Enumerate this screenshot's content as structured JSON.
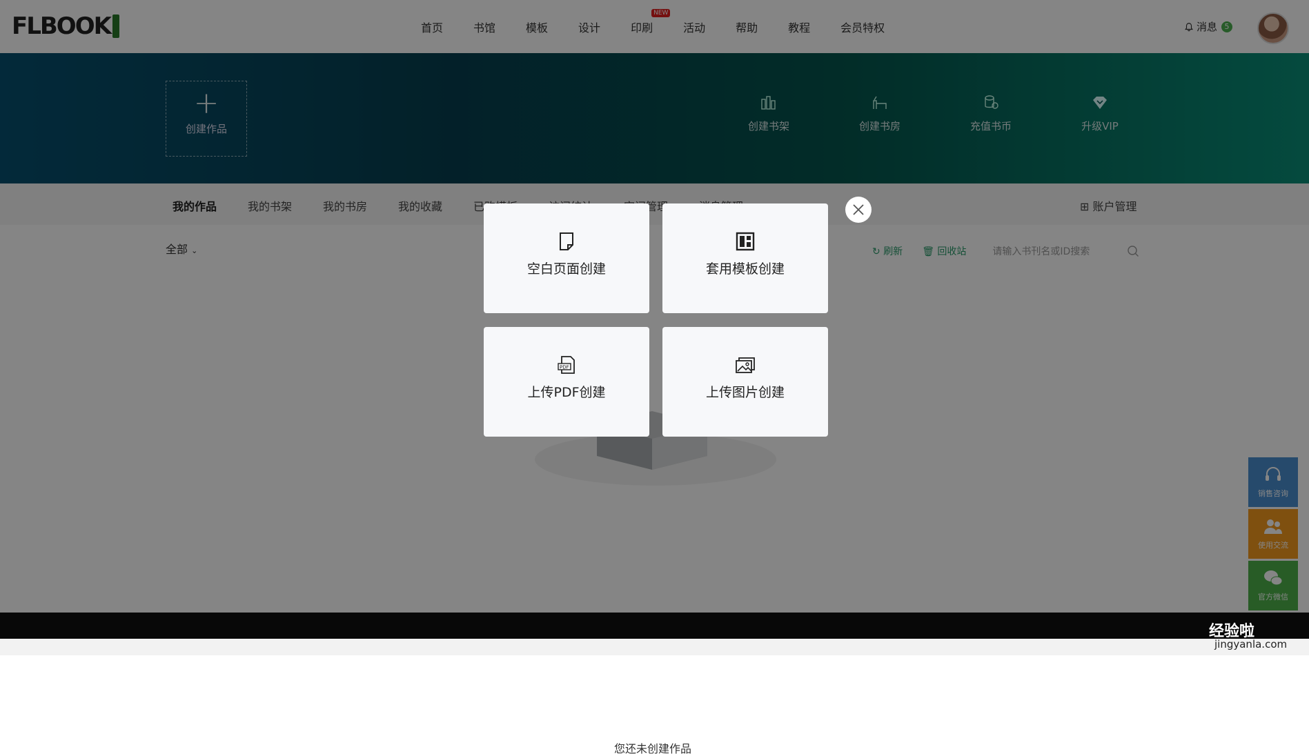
{
  "logo": {
    "text": "FLBOOK"
  },
  "nav": {
    "items": [
      {
        "label": "首页"
      },
      {
        "label": "书馆"
      },
      {
        "label": "模板"
      },
      {
        "label": "设计"
      },
      {
        "label": "印刷",
        "badge": "NEW"
      },
      {
        "label": "活动"
      },
      {
        "label": "帮助"
      },
      {
        "label": "教程"
      },
      {
        "label": "会员特权"
      }
    ],
    "messages_label": "消息",
    "messages_count": "5"
  },
  "banner": {
    "create_label": "创建作品",
    "actions": [
      {
        "label": "创建书架",
        "icon": "bookshelf-icon"
      },
      {
        "label": "创建书房",
        "icon": "study-icon"
      },
      {
        "label": "充值书币",
        "icon": "coins-icon"
      },
      {
        "label": "升级VIP",
        "icon": "vip-diamond-icon"
      }
    ]
  },
  "subnav": {
    "items": [
      {
        "label": "我的作品",
        "active": true
      },
      {
        "label": "我的书架"
      },
      {
        "label": "我的书房"
      },
      {
        "label": "我的收藏"
      },
      {
        "label": "已购模板"
      },
      {
        "label": "访问统计"
      },
      {
        "label": "空间管理"
      },
      {
        "label": "消息管理"
      }
    ],
    "account_label": "账户管理"
  },
  "content": {
    "filter_label": "全部",
    "refresh_label": "刷新",
    "recycle_label": "回收站",
    "search_placeholder": "请输入书刊名或ID搜索",
    "empty_text": "您还未创建作品"
  },
  "side_float": [
    {
      "label": "销售咨询",
      "color": "#4a8fd0"
    },
    {
      "label": "使用交流",
      "color": "#f39a1e"
    },
    {
      "label": "官方微信",
      "color": "#4db04a"
    }
  ],
  "modal": {
    "options": [
      {
        "label": "空白页面创建",
        "icon": "blank-page-icon"
      },
      {
        "label": "套用模板创建",
        "icon": "template-icon"
      },
      {
        "label": "上传PDF创建",
        "icon": "pdf-icon"
      },
      {
        "label": "上传图片创建",
        "icon": "image-icon"
      }
    ]
  },
  "watermark": {
    "text": "经验啦",
    "sub": "jingyanla.com"
  }
}
